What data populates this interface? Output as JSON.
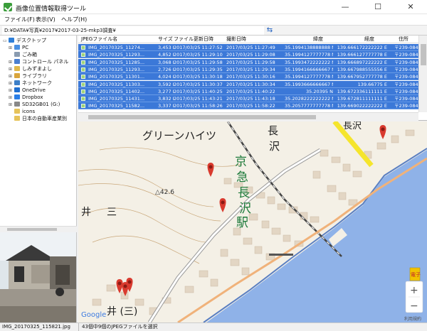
{
  "app": {
    "title": "画像位置情報取得ツール",
    "minimize": "—",
    "maximize": "☐",
    "close": "✕"
  },
  "menu": [
    {
      "label": "ファイル(F)"
    },
    {
      "label": "表示(V)"
    },
    {
      "label": "ヘルプ(H)"
    }
  ],
  "path": {
    "value": "D:¥DATA¥写真¥2017¥2017-03-25-mkp3調査¥",
    "refresh_icon": "refresh-icon"
  },
  "tree": {
    "items": [
      {
        "label": "デスクトップ",
        "level": 0,
        "icon": "#2f7fd8",
        "exp": "▭"
      },
      {
        "label": "PC",
        "level": 1,
        "icon": "#4a90e2",
        "exp": "⊞"
      },
      {
        "label": "ごみ箱",
        "level": 1,
        "icon": "#8a9bb0",
        "exp": ""
      },
      {
        "label": "コントロール パネル",
        "level": 1,
        "icon": "#4a7fd0",
        "exp": "⊞"
      },
      {
        "label": "しみずまよし",
        "level": 1,
        "icon": "#e0b84a",
        "exp": "⊞"
      },
      {
        "label": "ライブラリ",
        "level": 1,
        "icon": "#d9a53c",
        "exp": "⊞"
      },
      {
        "label": "ネットワーク",
        "level": 1,
        "icon": "#3c7fc8",
        "exp": "⊞"
      },
      {
        "label": "OneDrive",
        "level": 1,
        "icon": "#1f6fd0",
        "exp": "⊞"
      },
      {
        "label": "Dropbox",
        "level": 1,
        "icon": "#2a7ee6",
        "exp": "⊞"
      },
      {
        "label": "SD32GB01 (G:)",
        "level": 1,
        "icon": "#888888",
        "exp": "⊞"
      },
      {
        "label": "icons",
        "level": 1,
        "icon": "#e6c35a",
        "exp": ""
      },
      {
        "label": "日本の自動車産業別",
        "level": 1,
        "icon": "#e6c35a",
        "exp": ""
      }
    ]
  },
  "filelist": {
    "columns": [
      "JPEGファイル名",
      "サイズ",
      "ファイル更新日時",
      "撮影日時",
      "緯度",
      "経度",
      "住所"
    ],
    "rows": [
      [
        "IMG_20170325_11274...",
        "3,453 KB",
        "2017/03/25 11:27:52",
        "2017/03/25 11:27:49",
        "35.1994138888888 N",
        "139.666172222222 E",
        "〒239-0843 神奈"
      ],
      [
        "IMG_20170325_11293...",
        "4,852 KB",
        "2017/03/25 11:29:10",
        "2017/03/25 11:29:08",
        "35.1994127777778 N",
        "139.666127777778 E",
        "〒239-0843 神奈"
      ],
      [
        "IMG_20170325_11285...",
        "3,068 KB",
        "2017/03/25 11:29:58",
        "2017/03/25 11:29:58",
        "35.1993472222222 N",
        "139.666897222222 E",
        "〒239-0843 神奈"
      ],
      [
        "IMG_20170325_11293...",
        "2,726 KB",
        "2017/03/25 11:29:35",
        "2017/03/25 11:29:34",
        "35.1994166666667 N",
        "139.667988555556 E",
        "〒239-0843 神奈"
      ],
      [
        "IMG_20170325_11301...",
        "4,024 KB",
        "2017/03/25 11:30:18",
        "2017/03/25 11:30:16",
        "35.1994127777778 N",
        "139.667952777778 E",
        "〒239-0843 神奈"
      ],
      [
        "IMG_20170325_11303...",
        "3,592 KB",
        "2017/03/25 11:30:37",
        "2017/03/25 11:30:34",
        "35.1993666666667 N",
        "139.66775 E",
        "〒239-0843 神奈"
      ],
      [
        "IMG_20170325_11402...",
        "3,277 KB",
        "2017/03/25 11:40:25",
        "2017/03/25 11:40:22",
        "35.20395 N",
        "139.672336111111 E",
        "〒239-0842 神奈"
      ],
      [
        "IMG_20170325_11431...",
        "3,832 KB",
        "2017/03/25 11:43:21",
        "2017/03/25 11:43:18",
        "35.2028222222222 N",
        "139.672811111111 E",
        "〒239-0842 神奈"
      ],
      [
        "IMG_20170325_11582...",
        "3,337 KB",
        "2017/03/25 11:58:26",
        "2017/03/25 11:58:22",
        "35.2057777777778 N",
        "139.669022222222 E",
        "〒239-0842 神奈"
      ]
    ]
  },
  "map": {
    "labels": {
      "green_heights": "グリーンハイツ",
      "keikyu": "京",
      "keikyu2": "急",
      "naga": "長",
      "sawa": "沢",
      "eki": "駅",
      "naga_top": "長",
      "sawa_top": "沢",
      "naga_top2": "長沢",
      "elev": "△42.6",
      "ii": "井",
      "san": "三",
      "bottom_label": "井 (三)",
      "google": "Google",
      "terms": "利用規約",
      "zoom_in": "+",
      "zoom_out": "−",
      "gsi": "電子"
    }
  },
  "status": {
    "filename": "IMG_20170325_115821.jpg",
    "selection": "43個中9個のJPEGファイルを選択"
  }
}
